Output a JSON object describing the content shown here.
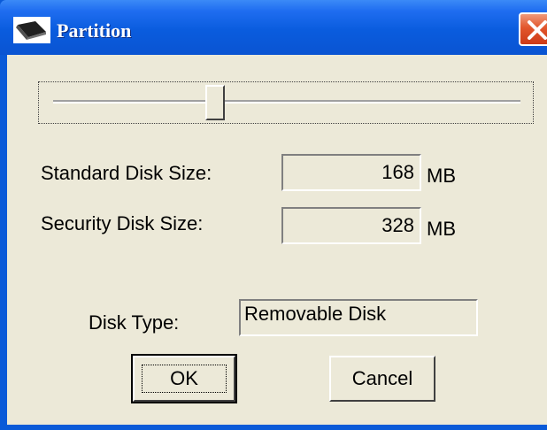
{
  "window": {
    "title": "Partition",
    "icon": "disk-icon",
    "close_icon": "close-icon"
  },
  "slider": {
    "fraction": 0.34
  },
  "fields": {
    "standard_label": "Standard Disk Size:",
    "standard_value": "168",
    "standard_unit": "MB",
    "security_label": "Security Disk Size:",
    "security_value": "328",
    "security_unit": "MB",
    "disk_type_label": "Disk Type:",
    "disk_type_value": "Removable Disk"
  },
  "buttons": {
    "ok_label": "OK",
    "cancel_label": "Cancel"
  },
  "colors": {
    "titlebar": "#0a5cde",
    "dialog_bg": "#ece9d8",
    "close": "#e2562c"
  }
}
